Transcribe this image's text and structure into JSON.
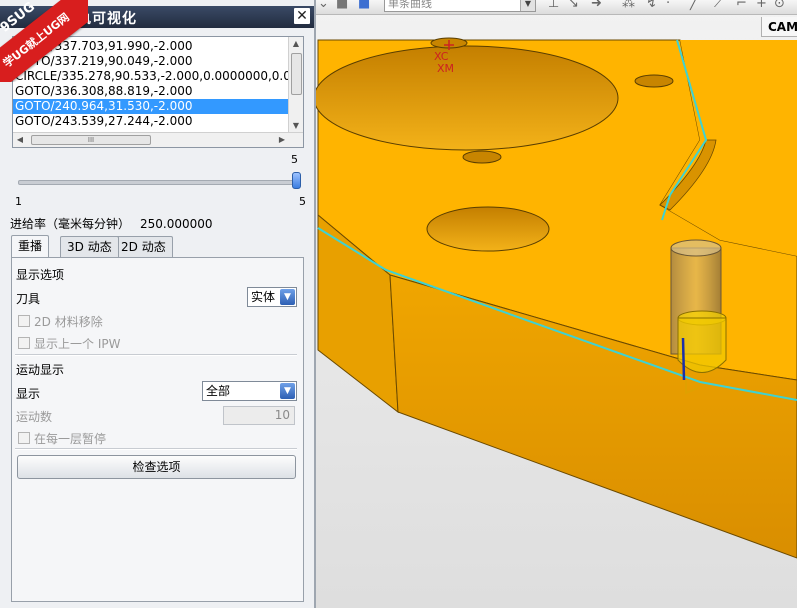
{
  "toolbar": {
    "curve_combo_value": "单条曲线",
    "tab_cam": "CAM"
  },
  "viewport": {
    "axis_label_top": "XC",
    "axis_label_bottom": "XM",
    "colors": {
      "part_top": "#ffb400",
      "part_side": "#e59a00",
      "part_hole": "#e8a100",
      "toolpath": "#3fd2d2",
      "tool": "#c9a05a",
      "background": "#e6e6e6"
    }
  },
  "watermark": {
    "brand": "9SUG",
    "slogan": "学UG就上UG网"
  },
  "dialog": {
    "title": "刀轨可视化",
    "list_items": [
      "GOTO/337.703,91.990,-2.000",
      "GOTO/337.219,90.049,-2.000",
      "CIRCLE/335.278,90.533,-2.000,0.0000000,0.0",
      "GOTO/336.308,88.819,-2.000",
      "GOTO/240.964,31.530,-2.000",
      "GOTO/243.539,27.244,-2.000"
    ],
    "selected_index": 4,
    "hscroll_thumb_label": "III",
    "slider": {
      "min": "1",
      "max": "5",
      "current": "5",
      "position": 1.0
    },
    "feedrate": {
      "label": "进给率（毫米每分钟）",
      "value": "250.000000"
    },
    "tabs": [
      {
        "label": "重播",
        "active": true
      },
      {
        "label": "3D 动态",
        "active": false
      },
      {
        "label": "2D 动态",
        "active": false
      }
    ],
    "display_options": {
      "section": "显示选项",
      "tool_label": "刀具",
      "tool_value": "实体",
      "chk_2d_material": "2D 材料移除",
      "chk_prev_ipw": "显示上一个 IPW"
    },
    "motion_display": {
      "section": "运动显示",
      "display_label": "显示",
      "display_value": "全部",
      "count_label": "运动数",
      "count_value": "10",
      "chk_pause_layer": "在每一层暂停"
    },
    "check_button": "检查选项"
  }
}
